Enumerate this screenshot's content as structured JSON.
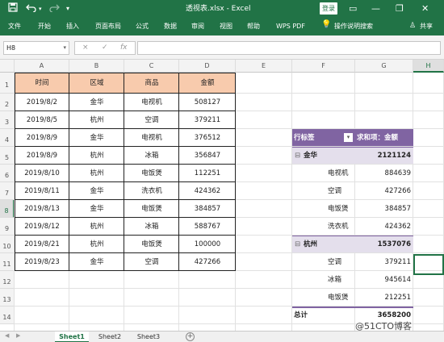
{
  "window": {
    "title": "透视表.xlsx  -  Excel",
    "login_label": "登录",
    "controls": [
      "▭",
      "—",
      "❐",
      "✕"
    ]
  },
  "quick_access": {
    "save_icon": "save-icon",
    "undo_icon": "undo-icon",
    "redo_icon": "redo-icon"
  },
  "ribbon": {
    "tabs": [
      "文件",
      "开始",
      "插入",
      "页面布局",
      "公式",
      "数据",
      "审阅",
      "视图",
      "帮助",
      "WPS PDF",
      "操作说明搜索"
    ],
    "share_label": "共享",
    "colors": {
      "brand": "#217346"
    }
  },
  "formula_bar": {
    "name_box": "H8",
    "cancel_glyph": "×",
    "confirm_glyph": "✓",
    "fx_glyph": "fx",
    "value": ""
  },
  "grid": {
    "columns": [
      "A",
      "B",
      "C",
      "D",
      "E",
      "F",
      "G"
    ],
    "rows": [
      "1",
      "2",
      "3",
      "4",
      "5",
      "6",
      "7",
      "8",
      "9",
      "10",
      "11",
      "12",
      "13",
      "14"
    ],
    "selected_column": "H",
    "selected_row": "8"
  },
  "table": {
    "headers": [
      "时间",
      "区域",
      "商品",
      "金额"
    ],
    "rows": [
      [
        "2019/8/2",
        "金华",
        "电视机",
        "508127"
      ],
      [
        "2019/8/5",
        "杭州",
        "空调",
        "379211"
      ],
      [
        "2019/8/9",
        "金华",
        "电视机",
        "376512"
      ],
      [
        "2019/8/9",
        "杭州",
        "冰箱",
        "356847"
      ],
      [
        "2019/8/10",
        "杭州",
        "电饭煲",
        "112251"
      ],
      [
        "2019/8/11",
        "金华",
        "洗衣机",
        "424362"
      ],
      [
        "2019/8/13",
        "金华",
        "电饭煲",
        "384857"
      ],
      [
        "2019/8/12",
        "杭州",
        "冰箱",
        "588767"
      ],
      [
        "2019/8/21",
        "杭州",
        "电饭煲",
        "100000"
      ],
      [
        "2019/8/23",
        "金华",
        "空调",
        "427266"
      ]
    ],
    "header_color": "#f8cbad"
  },
  "pivot": {
    "row_label": "行标签",
    "value_label": "求和项：金额",
    "groups": [
      {
        "name": "金华",
        "total": "2121124",
        "items": [
          {
            "name": "电视机",
            "value": "884639"
          },
          {
            "name": "空调",
            "value": "427266"
          },
          {
            "name": "电饭煲",
            "value": "384857"
          },
          {
            "name": "洗衣机",
            "value": "424362"
          }
        ]
      },
      {
        "name": "杭州",
        "total": "1537076",
        "items": [
          {
            "name": "空调",
            "value": "379211"
          },
          {
            "name": "冰箱",
            "value": "945614"
          },
          {
            "name": "电饭煲",
            "value": "212251"
          }
        ]
      }
    ],
    "grand_total_label": "总计",
    "grand_total": "3658200",
    "collapse_glyph": "⊟",
    "header_color": "#8064a2",
    "group_color": "#e4dfec"
  },
  "sheets": {
    "tabs": [
      "Sheet1",
      "Sheet2",
      "Sheet3"
    ],
    "active": "Sheet1",
    "add_glyph": "+"
  },
  "watermark": "@51CTO博客"
}
